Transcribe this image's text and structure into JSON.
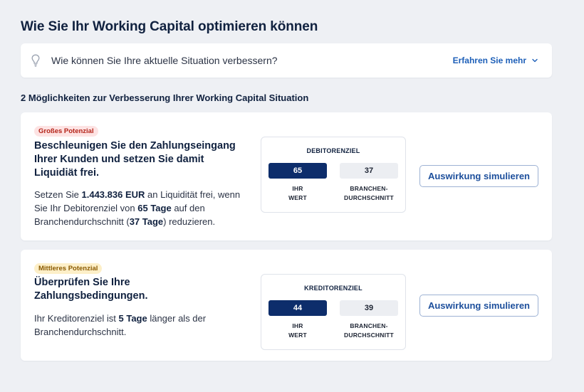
{
  "page": {
    "title": "Wie Sie Ihr Working Capital optimieren können"
  },
  "info_bar": {
    "icon": "lightbulb-icon",
    "text": "Wie können Sie Ihre aktuelle Situation verbessern?",
    "link_label": "Erfahren Sie mehr",
    "link_icon": "chevron-down-icon"
  },
  "section": {
    "heading": "2 Möglichkeiten zur Verbesserung Ihrer Working Capital Situation"
  },
  "colors": {
    "accent": "#1d5fb8",
    "navy": "#0d2d6b",
    "badge_high_bg": "#fde3e3",
    "badge_high_fg": "#b42318",
    "badge_mid_bg": "#fdefc8",
    "badge_mid_fg": "#8a5a00"
  },
  "cards": [
    {
      "badge": "Großes Potenzial",
      "title": "Beschleunigen Sie den Zahlungseingang Ihrer Kunden und setzen Sie damit Liquidiät frei.",
      "desc": {
        "p1": "Setzen Sie ",
        "amount": "1.443.836 EUR",
        "p2": " an Liquidität frei, wenn Sie Ihr Debitorenziel von ",
        "days": "65 Tage",
        "p3": " auf den Branchendurchschnitt (",
        "bench": "37 Tage",
        "p4": ") reduzieren."
      },
      "metric": {
        "title": "DEBITORENZIEL",
        "your_value": "65",
        "industry_value": "37",
        "your_label_1": "IHR",
        "your_label_2": "WERT",
        "industry_label_1": "BRANCHEN-",
        "industry_label_2": "DURCHSCHNITT"
      },
      "button": "Auswirkung simulieren"
    },
    {
      "badge": "Mittleres Potenzial",
      "title": "Überprüfen Sie Ihre Zahlungsbedingungen.",
      "desc": {
        "p1": "Ihr Kreditorenziel ist ",
        "days": "5 Tage",
        "p2": " länger als der Branchendurchschnitt."
      },
      "metric": {
        "title": "KREDITORENZIEL",
        "your_value": "44",
        "industry_value": "39",
        "your_label_1": "IHR",
        "your_label_2": "WERT",
        "industry_label_1": "BRANCHEN-",
        "industry_label_2": "DURCHSCHNITT"
      },
      "button": "Auswirkung simulieren"
    }
  ]
}
